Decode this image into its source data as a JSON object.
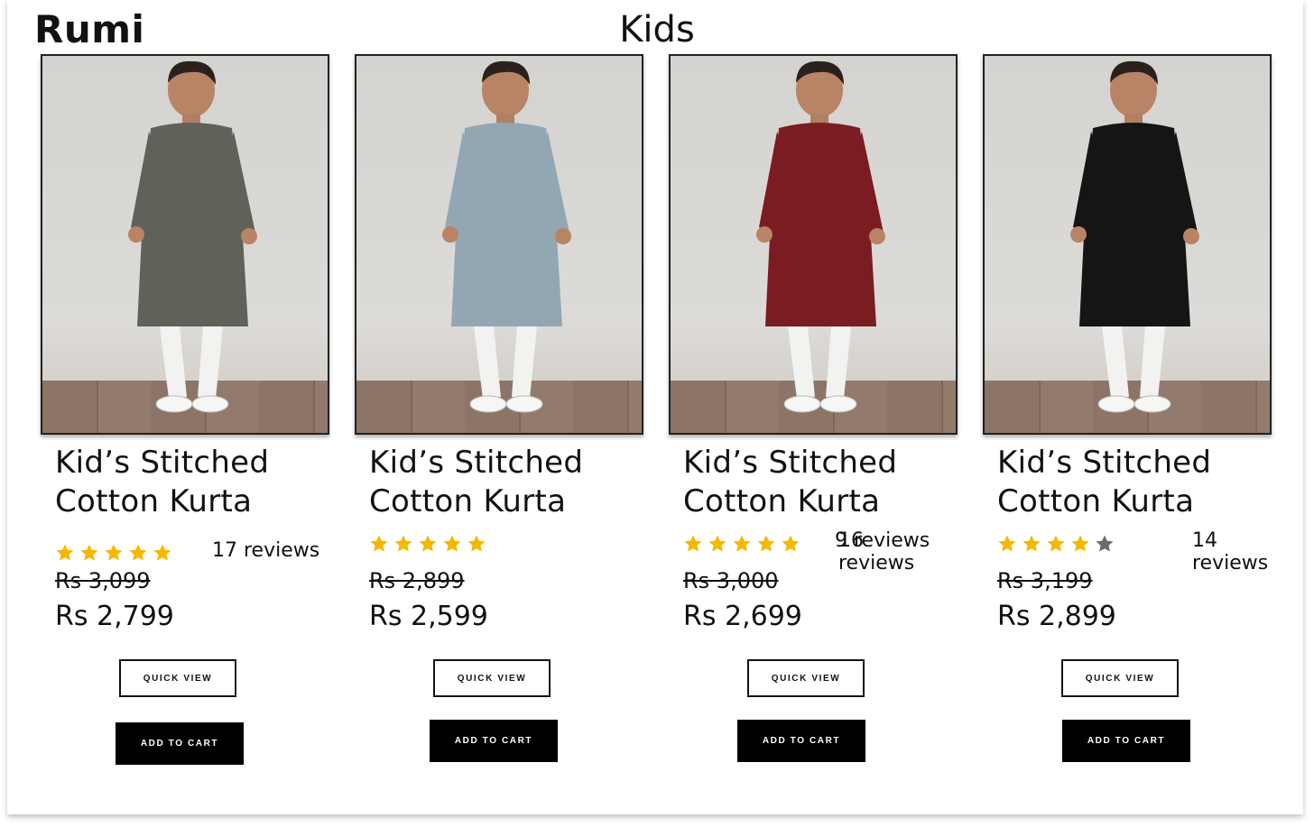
{
  "brand": "Rumi",
  "page_title": "Kids",
  "colors": {
    "star_filled": "#f5b800",
    "star_empty": "#6b6b6b",
    "button_dark": "#000000"
  },
  "products": [
    {
      "name_line1": "Kid’s Stitched",
      "name_line2": "Cotton Kurta",
      "rating": 5,
      "reviews": "17 reviews",
      "old_price": "Rs 3,099",
      "price": "Rs 2,799",
      "quick_view": "QUICK VIEW",
      "add_to_cart": "ADD TO CART",
      "kurta_color": "#5e6259",
      "image": "boy-in-olive-kurta"
    },
    {
      "name_line1": "Kid’s Stitched",
      "name_line2": "Cotton Kurta",
      "rating": 5,
      "reviews": "16 reviews",
      "old_price": "Rs 2,899",
      "price": "Rs 2,599",
      "quick_view": "QUICK VIEW",
      "add_to_cart": "ADD TO CART",
      "kurta_color": "#92a7b3",
      "image": "boy-in-light-blue-kurta"
    },
    {
      "name_line1": "Kid’s Stitched",
      "name_line2": "Cotton Kurta",
      "rating": 5,
      "reviews": "9 reviews",
      "old_price": "Rs 3,000",
      "price": "Rs 2,699",
      "quick_view": "QUICK VIEW",
      "add_to_cart": "ADD TO CART",
      "kurta_color": "#7a1c22",
      "image": "boy-in-maroon-kurta"
    },
    {
      "name_line1": "Kid’s Stitched",
      "name_line2": "Cotton Kurta",
      "rating": 4,
      "reviews": "14 reviews",
      "old_price": "Rs 3,199",
      "price": "Rs 2,899",
      "quick_view": "QUICK VIEW",
      "add_to_cart": "ADD TO CART",
      "kurta_color": "#151515",
      "image": "boy-in-black-kurta"
    }
  ]
}
